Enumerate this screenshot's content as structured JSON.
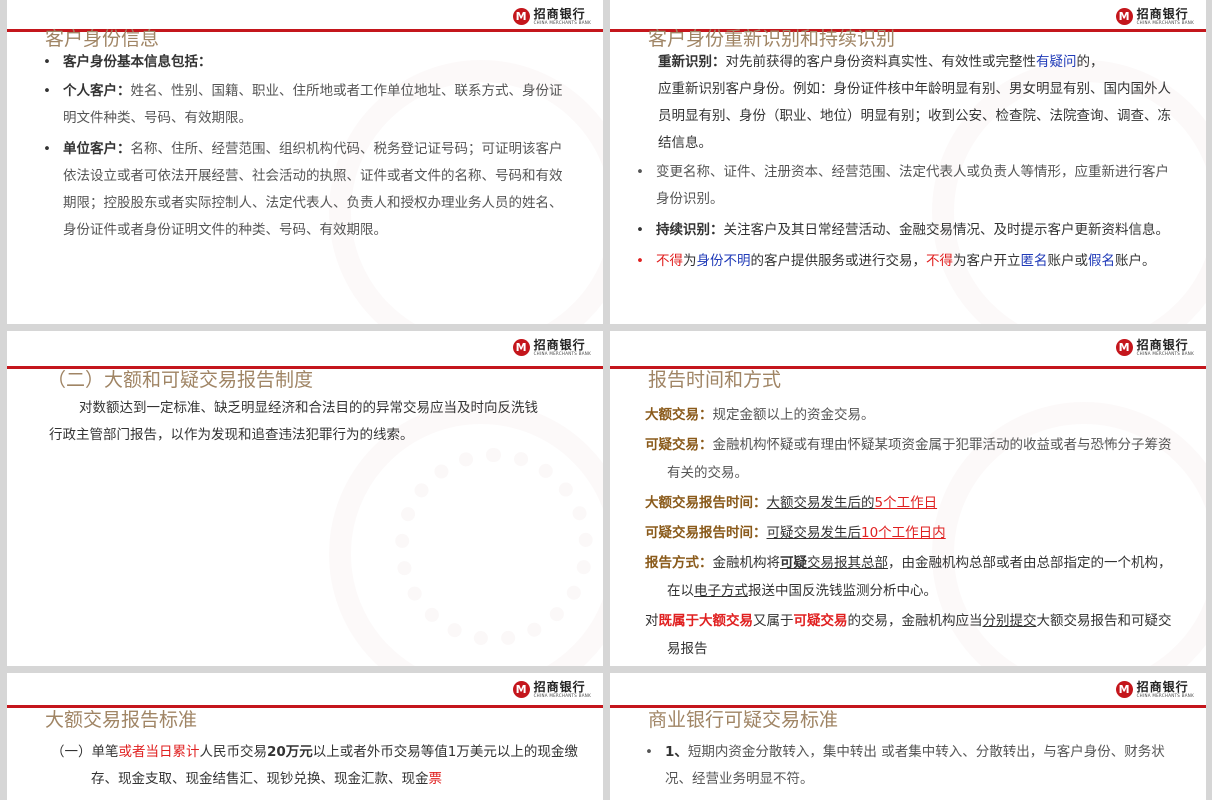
{
  "logo": {
    "cn": "招商银行",
    "en": "CHINA MERCHANTS BANK",
    "mark": "M"
  },
  "s1": {
    "title": "客户身份信息",
    "b1": "客户身份基本信息包括：",
    "b2_label": "个人客户：",
    "b2_text": "姓名、性别、国籍、职业、住所地或者工作单位地址、联系方式、身份证明文件种类、号码、有效期限。",
    "b3_label": "单位客户：",
    "b3_text": "名称、住所、经营范围、组织机构代码、税务登记证号码；可证明该客户依法设立或者可依法开展经营、社会活动的执照、证件或者文件的名称、号码和有效期限；控股股东或者实际控制人、法定代表人、负责人和授权办理业务人员的姓名、身份证件或者身份证明文件的种类、号码、有效期限。"
  },
  "s2": {
    "title": "客户身份重新识别和持续识别",
    "p1_label": "重新识别：",
    "p1_a": "对先前获得的客户身份资料真实性、有效性或完整性",
    "p1_b": "有疑问",
    "p1_c": "的，",
    "p1_d": "应重新识别客户身份。例如：身份证件核中年龄明显有别、男女明显有别、国内国外人员明显有别、身份（职业、地位）明显有别；收到公安、检查院、法院查询、调查、冻结信息。",
    "p2": "变更名称、证件、注册资本、经营范围、法定代表人或负责人等情形，应重新进行客户身份识别。",
    "p3_label": "持续识别：",
    "p3_text": "关注客户及其日常经营活动、金融交易情况、及时提示客户更新资料信息。",
    "p4_a": "不得",
    "p4_b": "为",
    "p4_c": "身份不明",
    "p4_d": "的客户提供服务或进行交易，",
    "p4_e": "不得",
    "p4_f": "为客户开立",
    "p4_g": "匿名",
    "p4_h": "账户或",
    "p4_i": "假名",
    "p4_j": "账户。"
  },
  "s3": {
    "title": "（二）大额和可疑交易报告制度",
    "body": "对数额达到一定标准、缺乏明显经济和合法目的的异常交易应当及时向反洗钱行政主管部门报告，以作为发现和追查违法犯罪行为的线索。"
  },
  "s4": {
    "title": "报告时间和方式",
    "l1_label": "大额交易：",
    "l1_text": "规定金额以上的资金交易。",
    "l2_label": "可疑交易：",
    "l2_text": "金融机构怀疑或有理由怀疑某项资金属于犯罪活动的收益或者与恐怖分子筹资有关的交易。",
    "l3_label": "大额交易报告时间：",
    "l3_a": "大额交易发生后的",
    "l3_b": "5个工作日",
    "l4_label": "可疑交易报告时间：",
    "l4_a": "可疑交易发生后",
    "l4_b": "10个工作日内",
    "l5_label": "报告方式：",
    "l5_a": "金融机构将",
    "l5_b": "可疑",
    "l5_c": "交易报其总部",
    "l5_d": "，由金融机构总部或者由总部指定的一个机构，在以",
    "l5_e": "电子方式",
    "l5_f": "报送中国反洗钱监测分析中心。",
    "l6_a": "对",
    "l6_b": "既属于大额交易",
    "l6_c": "又属于",
    "l6_d": "可疑交易",
    "l6_e": "的交易，金融机构应当",
    "l6_f": "分别提交",
    "l6_g": "大额交易报告和可疑交易报告"
  },
  "s5": {
    "title": "大额交易报告标准",
    "p_a": "（一）单笔",
    "p_b": "或者当日累计",
    "p_c": "人民币交易",
    "p_d": "20万元",
    "p_e": "以上或者外币交易等值1万美元以上的现金缴存、现金支取、现金结售汇、现钞兑换、现金汇款、现金",
    "p_f": "票"
  },
  "s6": {
    "title": "商业银行可疑交易标准",
    "p_a": "1、",
    "p_b": "短期内资金分散转入，集中转出 或者集中转入、分散转出，与客户身份、财务状况、经营业务明显不符。"
  },
  "colors": {
    "brand_red": "#c4161c",
    "title": "#a08565",
    "red_text": "#e02020",
    "blue_text": "#1f3ab8"
  }
}
